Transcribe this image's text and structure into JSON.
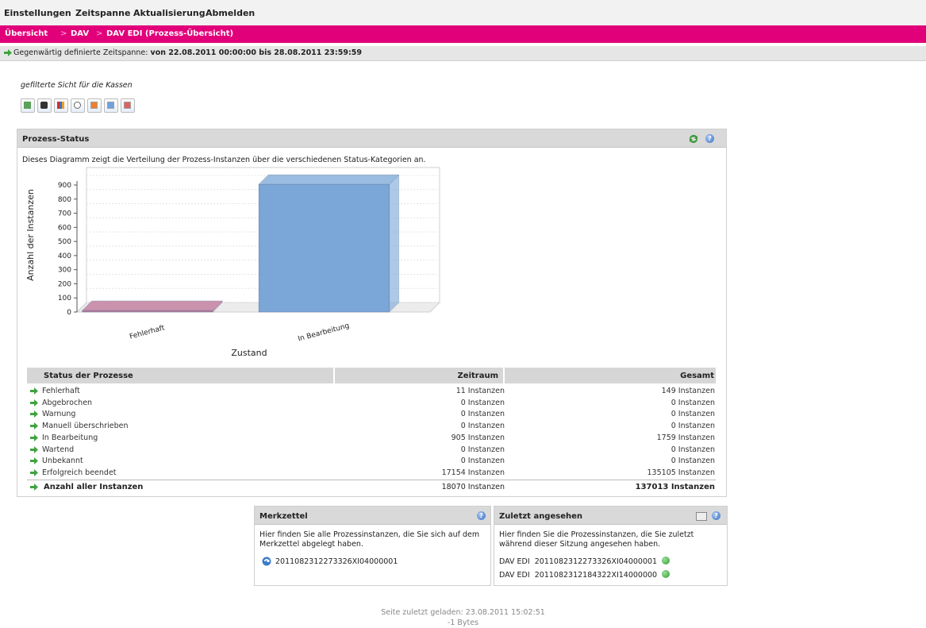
{
  "menu": {
    "items": [
      "Einstellungen",
      "Zeitspanne",
      "Aktualisierung",
      "Abmelden"
    ]
  },
  "breadcrumb": {
    "items": [
      "Übersicht",
      "DAV",
      "DAV EDI (Prozess-Übersicht)"
    ],
    "separator": ">"
  },
  "timespan": {
    "label": "Gegenwärtig definierte Zeitspanne:",
    "value": "von 22.08.2011 00:00:00  bis 28.08.2011 23:59:59"
  },
  "filter": {
    "label": "gefilterte Sicht für die Kassen"
  },
  "toolbar": {
    "icons": [
      "export-icon",
      "binoculars-icon",
      "bar-chart-icon",
      "clock-icon",
      "calendar-day-icon",
      "calendar-week-icon",
      "calendar-month-icon"
    ]
  },
  "status_panel": {
    "title": "Prozess-Status",
    "description": "Dieses Diagramm zeigt die Verteilung der Prozess-Instanzen über die verschiedenen Status-Kategorien an."
  },
  "chart_data": {
    "type": "bar",
    "categories": [
      "Fehlerhaft",
      "In Bearbeitung"
    ],
    "values": [
      11,
      905
    ],
    "title": "",
    "xlabel": "Zustand",
    "ylabel": "Anzahl der Instanzen",
    "ylim": [
      0,
      900
    ],
    "yticks": [
      0,
      100,
      200,
      300,
      400,
      500,
      600,
      700,
      800,
      900
    ],
    "colors": [
      "#c0749a",
      "#7aa6d8"
    ],
    "grid": true,
    "legend": "none"
  },
  "table": {
    "headers": [
      "Status der Prozesse",
      "Zeitraum",
      "Gesamt"
    ],
    "rows": [
      {
        "name": "Fehlerhaft",
        "zeitraum": "11 Instanzen",
        "gesamt": "149 Instanzen"
      },
      {
        "name": "Abgebrochen",
        "zeitraum": "0 Instanzen",
        "gesamt": "0 Instanzen"
      },
      {
        "name": "Warnung",
        "zeitraum": "0 Instanzen",
        "gesamt": "0 Instanzen"
      },
      {
        "name": "Manuell überschrieben",
        "zeitraum": "0 Instanzen",
        "gesamt": "0 Instanzen"
      },
      {
        "name": "In Bearbeitung",
        "zeitraum": "905 Instanzen",
        "gesamt": "1759 Instanzen"
      },
      {
        "name": "Wartend",
        "zeitraum": "0 Instanzen",
        "gesamt": "0 Instanzen"
      },
      {
        "name": "Unbekannt",
        "zeitraum": "0 Instanzen",
        "gesamt": "0 Instanzen"
      },
      {
        "name": "Erfolgreich beendet",
        "zeitraum": "17154 Instanzen",
        "gesamt": "135105 Instanzen"
      }
    ],
    "total": {
      "name": "Anzahl aller Instanzen",
      "zeitraum": "18070 Instanzen",
      "gesamt": "137013 Instanzen"
    }
  },
  "merkzettel": {
    "title": "Merkzettel",
    "description_line1": "Hier finden Sie alle Prozessinstanzen, die Sie sich auf dem",
    "description_line2": "Merkzettel abgelegt haben.",
    "items": [
      "2011082312273326XI04000001"
    ]
  },
  "zuletzt": {
    "title": "Zuletzt angesehen",
    "description_line1": "Hier finden Sie die Prozessinstanzen, die Sie zuletzt",
    "description_line2": "während dieser Sitzung angesehen haben.",
    "items": [
      {
        "prefix": "DAV EDI",
        "id": "2011082312273326XI04000001"
      },
      {
        "prefix": "DAV EDI",
        "id": "2011082312184322XI14000000"
      }
    ]
  },
  "footer": {
    "loaded": "Seite zuletzt geladen: 23.08.2011 15:02:51",
    "bytes": "-1 Bytes"
  }
}
